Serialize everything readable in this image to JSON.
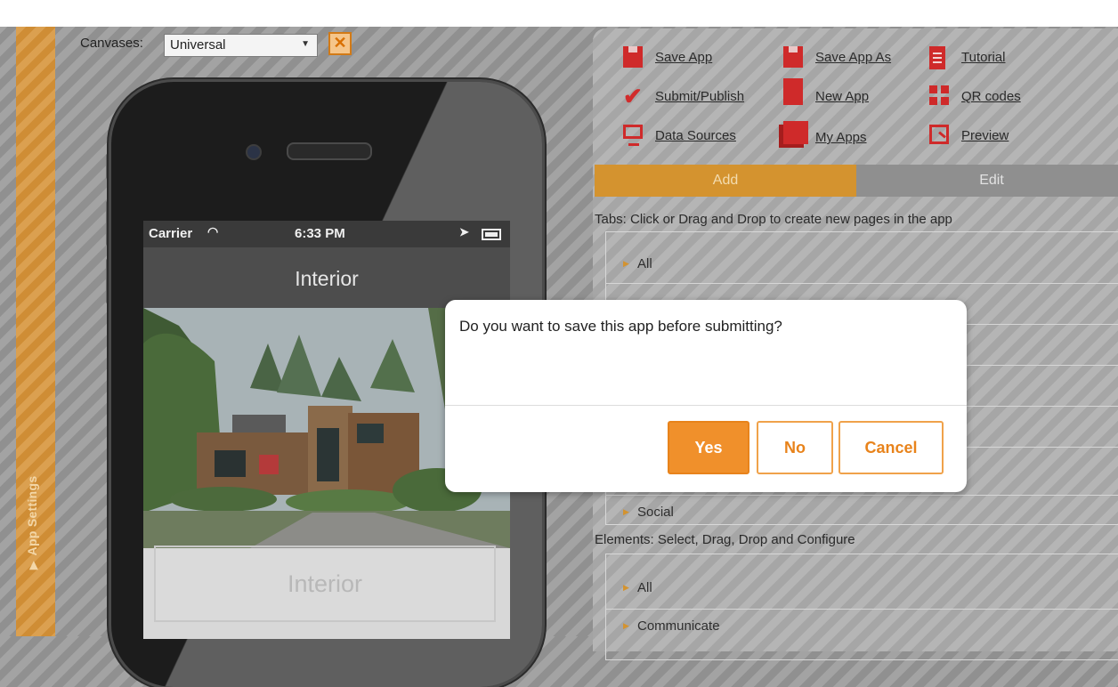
{
  "canvases": {
    "label": "Canvases:",
    "selected": "Universal",
    "close": "✕"
  },
  "sidebar": {
    "label": "App Settings"
  },
  "phone": {
    "carrier": "Carrier",
    "time": "6:33 PM",
    "nav_title": "Interior",
    "button_label": "Interior"
  },
  "toolbar": {
    "save_app": "Save App",
    "save_app_as": "Save App As",
    "tutorial": "Tutorial",
    "submit_publish": "Submit/Publish",
    "new_app": "New App",
    "qr_codes": "QR codes",
    "data_sources": "Data Sources",
    "my_apps": "My Apps",
    "preview": "Preview"
  },
  "tabs": {
    "add": "Add",
    "edit": "Edit"
  },
  "tabs_section": {
    "label": "Tabs: Click or Drag and Drop to create new pages in the app",
    "items": [
      "All",
      "Social"
    ]
  },
  "elements_section": {
    "label": "Elements: Select, Drag, Drop and Configure",
    "items": [
      "All",
      "Communicate"
    ]
  },
  "dialog": {
    "message": "Do you want to save this app before submitting?",
    "yes": "Yes",
    "no": "No",
    "cancel": "Cancel"
  }
}
